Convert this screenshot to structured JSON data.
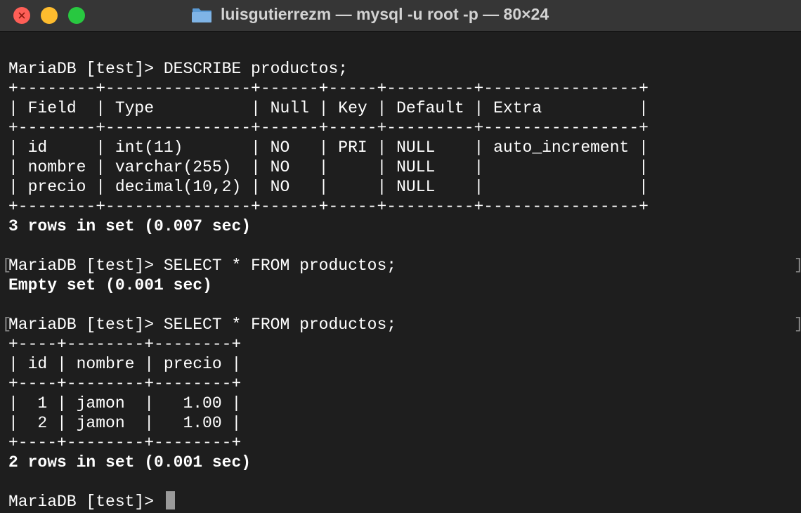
{
  "window": {
    "title": "luisgutierrezm — mysql -u root -p — 80×24"
  },
  "icons": {
    "folder": "folder-icon",
    "close": "close-icon"
  },
  "colors": {
    "close": "#fe5f57",
    "minimize": "#febc2e",
    "zoom": "#28c840",
    "background": "#1e1e1e"
  },
  "terminal": {
    "lines": [
      "MariaDB [test]> DESCRIBE productos;",
      "+--------+---------------+------+-----+---------+----------------+",
      "| Field  | Type          | Null | Key | Default | Extra          |",
      "+--------+---------------+------+-----+---------+----------------+",
      "| id     | int(11)       | NO   | PRI | NULL    | auto_increment |",
      "| nombre | varchar(255)  | NO   |     | NULL    |                |",
      "| precio | decimal(10,2) | NO   |     | NULL    |                |",
      "+--------+---------------+------+-----+---------+----------------+",
      "3 rows in set (0.007 sec)",
      "",
      "MariaDB [test]> SELECT * FROM productos;",
      "Empty set (0.001 sec)",
      "",
      "MariaDB [test]> SELECT * FROM productos;",
      "+----+--------+--------+",
      "| id | nombre | precio |",
      "+----+--------+--------+",
      "|  1 | jamon  |   1.00 |",
      "|  2 | jamon  |   1.00 |",
      "+----+--------+--------+",
      "2 rows in set (0.001 sec)",
      "",
      "MariaDB [test]> "
    ]
  }
}
